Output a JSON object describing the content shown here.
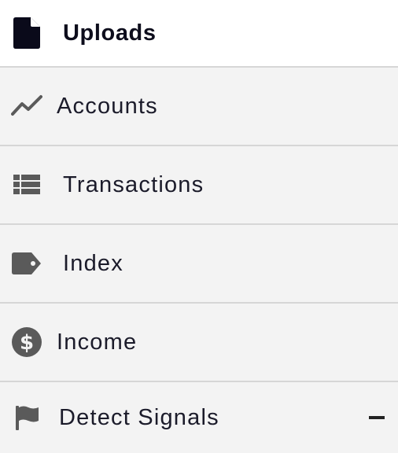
{
  "nav": {
    "items": [
      {
        "label": "Uploads",
        "icon": "file-icon",
        "active": true
      },
      {
        "label": "Accounts",
        "icon": "line-chart-icon"
      },
      {
        "label": "Transactions",
        "icon": "list-icon"
      },
      {
        "label": "Index",
        "icon": "tag-icon"
      },
      {
        "label": "Income",
        "icon": "dollar-circle-icon"
      },
      {
        "label": "Detect Signals",
        "icon": "flag-icon",
        "toggle": "collapse-icon"
      }
    ]
  },
  "colors": {
    "active_bg": "#ffffff",
    "item_bg": "#f3f3f3",
    "divider": "#d6d6d6",
    "icon_dark": "#0a0a1a",
    "icon_gray": "#5a5a5a"
  }
}
